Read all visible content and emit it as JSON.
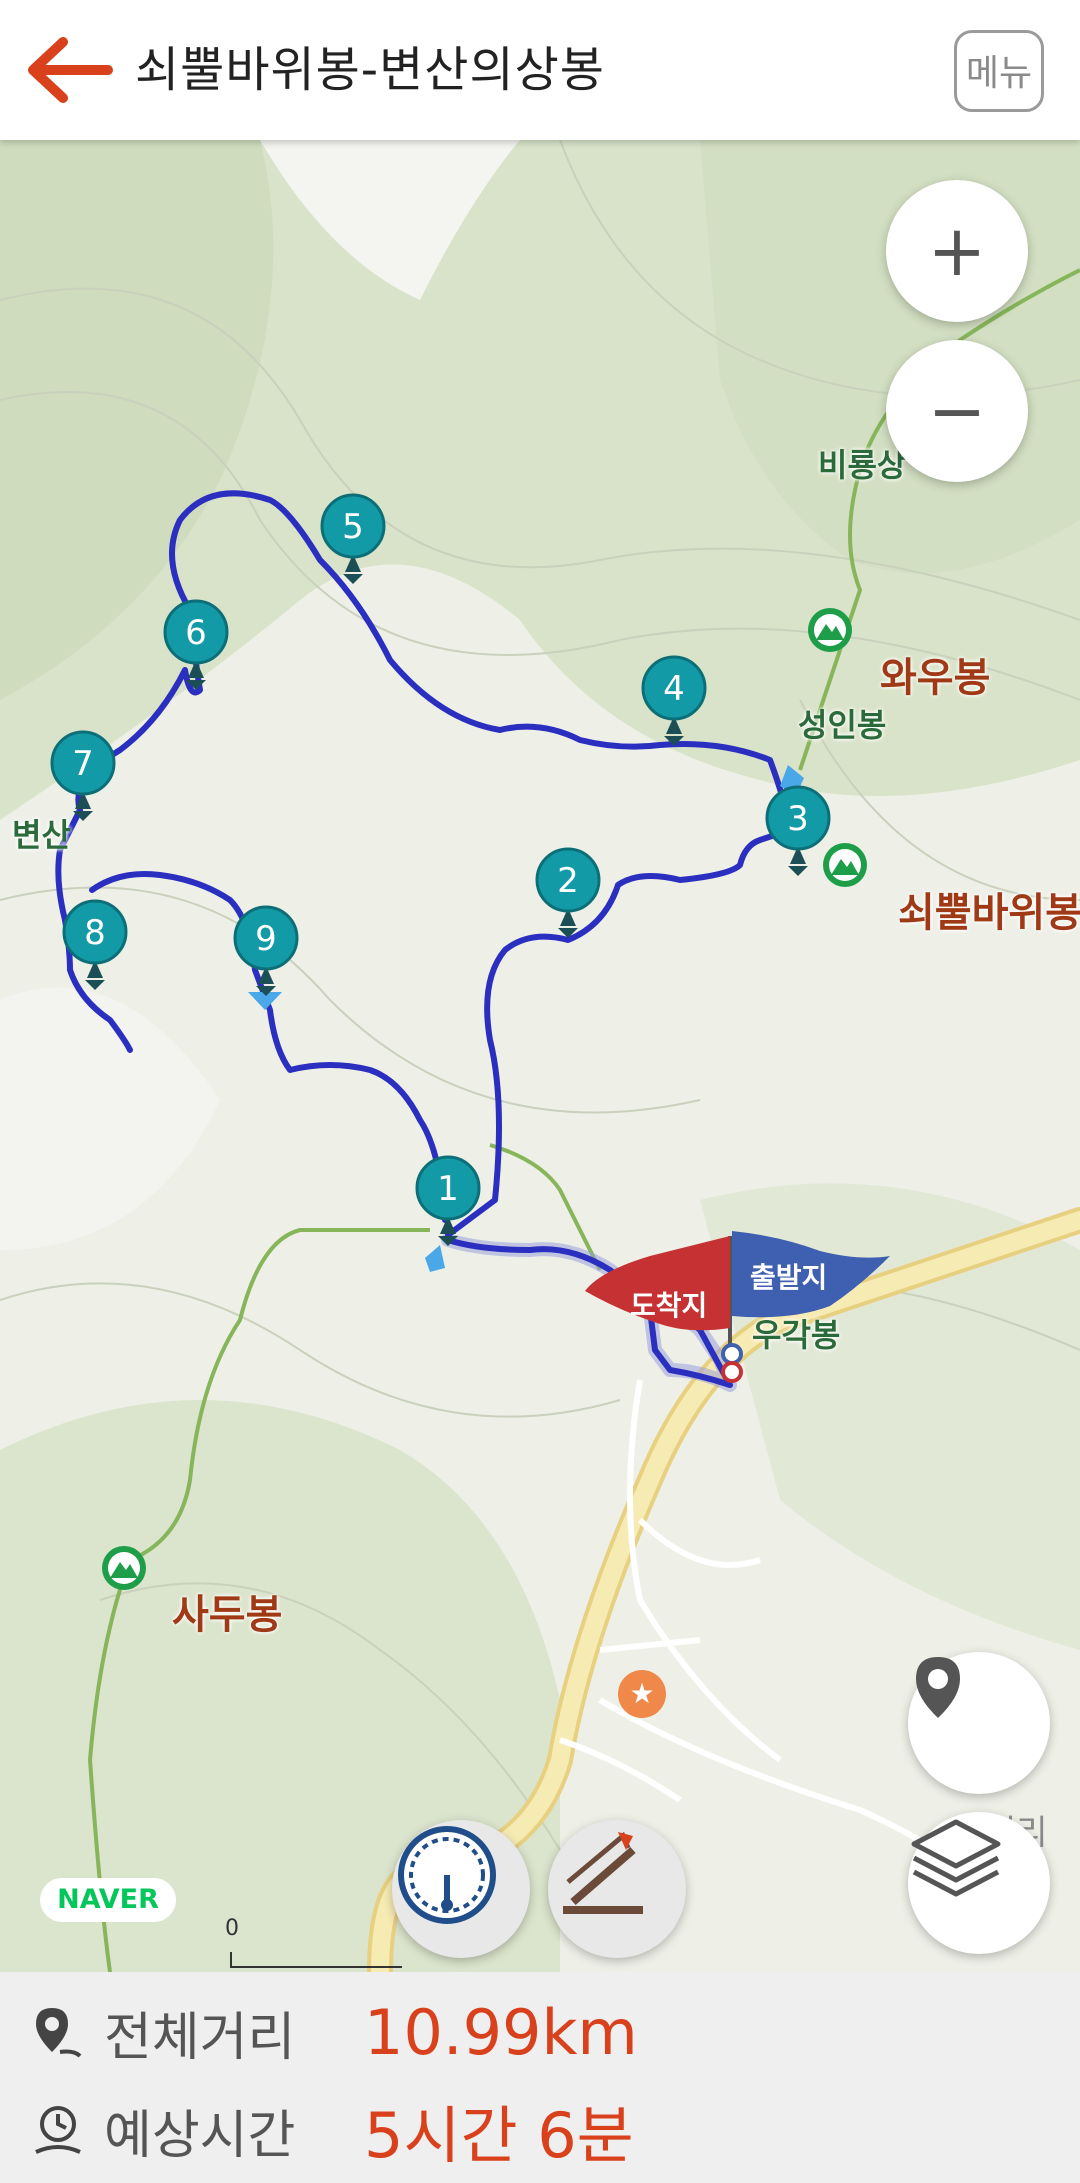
{
  "header": {
    "title": "쇠뿔바위봉-변산의상봉",
    "menu_label": "메뉴",
    "back_icon": "back-arrow-icon"
  },
  "colors": {
    "accent": "#d8411b",
    "route": "#2b2fc0",
    "waypoint": "#129aa6",
    "start_flag": "#3f5fb0",
    "end_flag": "#c63233",
    "peak_label": "#a03a16",
    "trail": "#7ab04c",
    "road": "#f1de93"
  },
  "map": {
    "zoom_in_label": "+",
    "zoom_out_label": "−",
    "peaks": [
      {
        "name": "와우봉"
      },
      {
        "name": "성인봉"
      },
      {
        "name": "쇠뿔바위봉"
      },
      {
        "name": "비룡상"
      },
      {
        "name": "변산"
      },
      {
        "name": "우각봉"
      },
      {
        "name": "사두봉"
      }
    ],
    "places": [
      {
        "name": "신리"
      }
    ],
    "waypoints": [
      "1",
      "2",
      "3",
      "4",
      "5",
      "6",
      "7",
      "8",
      "9"
    ],
    "start_flag_label": "출발지",
    "end_flag_label": "도착지",
    "brand": "NAVER",
    "scale_label": "0",
    "tool_icons": [
      "speedometer-icon",
      "slope-icon"
    ],
    "side_icons": [
      "location-pin-icon",
      "layers-icon"
    ]
  },
  "summary": {
    "distance_label": "전체거리",
    "distance_value": "10.99km",
    "time_label": "예상시간",
    "time_value": "5시간 6분"
  }
}
